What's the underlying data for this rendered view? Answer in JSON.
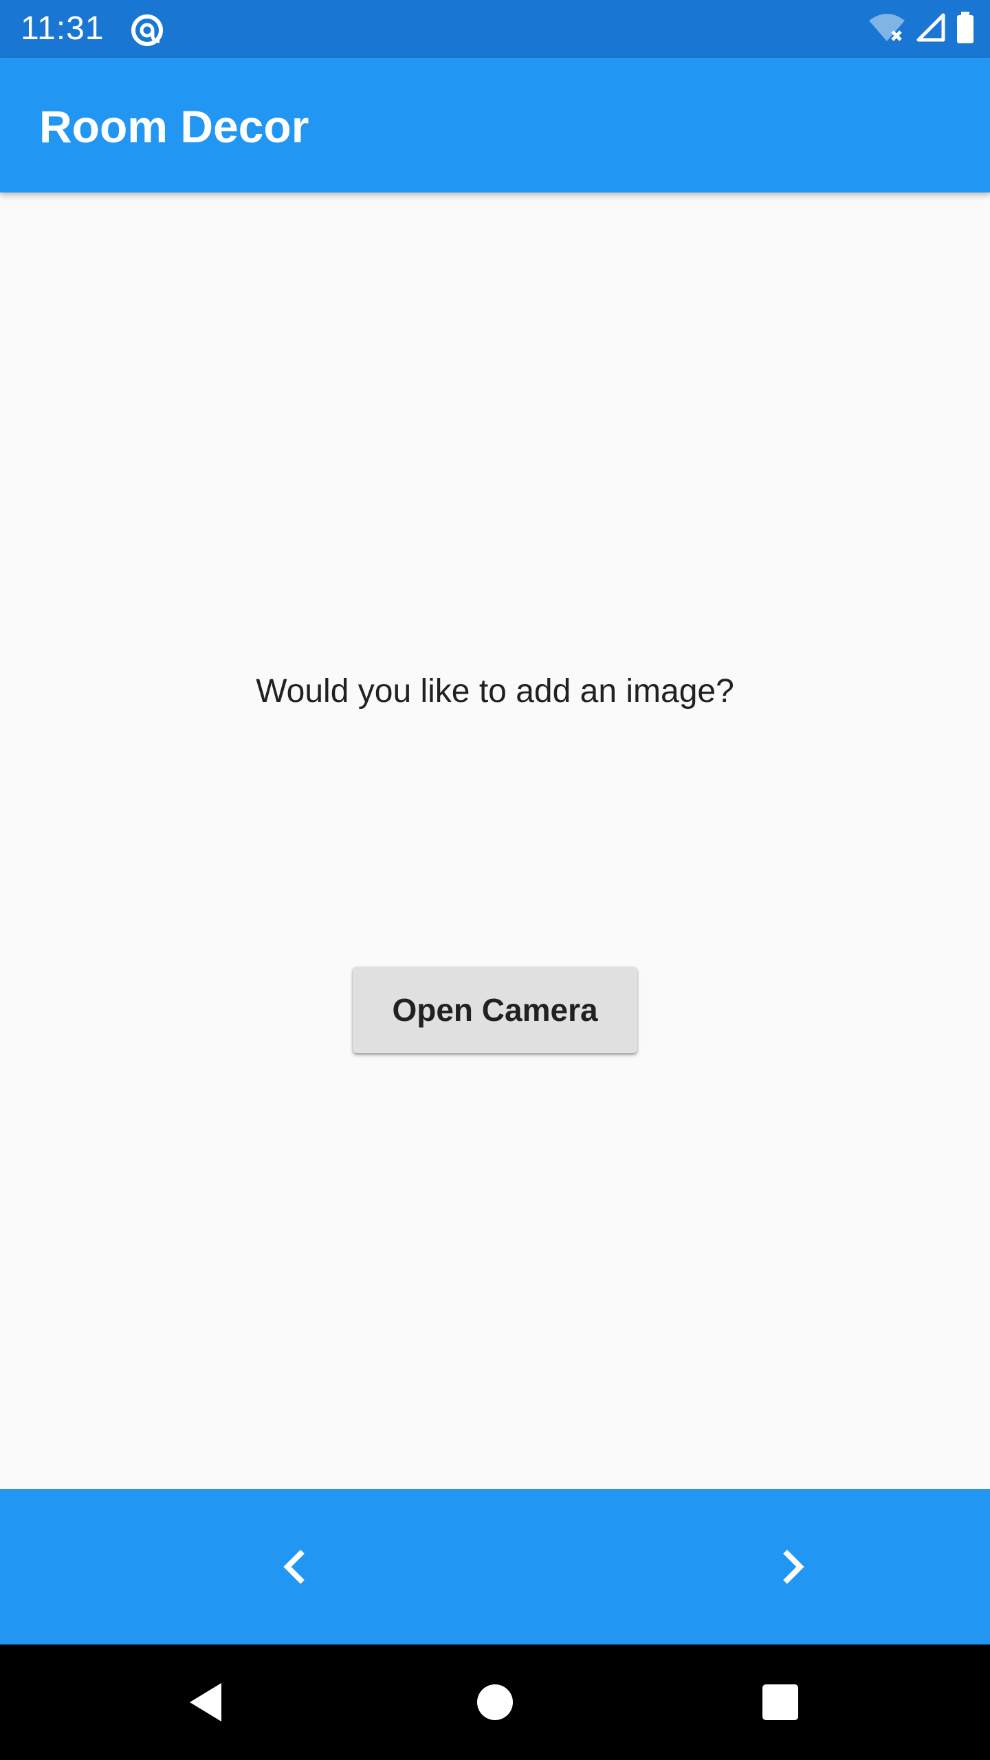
{
  "status_bar": {
    "time": "11:31",
    "icons": {
      "left": "at-sign-icon",
      "wifi": "wifi-off-icon",
      "signal": "cell-signal-icon",
      "battery": "battery-full-icon"
    },
    "background": "#1976d2"
  },
  "app_bar": {
    "title": "Room Decor",
    "background": "#2196f3"
  },
  "main": {
    "prompt": "Would you like to add an image?",
    "open_camera_label": "Open Camera"
  },
  "bottom_bar": {
    "prev_icon": "chevron-left-icon",
    "next_icon": "chevron-right-icon",
    "background": "#2196f3"
  },
  "system_nav": {
    "back_icon": "back-triangle-icon",
    "home_icon": "home-circle-icon",
    "recents_icon": "recents-square-icon"
  }
}
